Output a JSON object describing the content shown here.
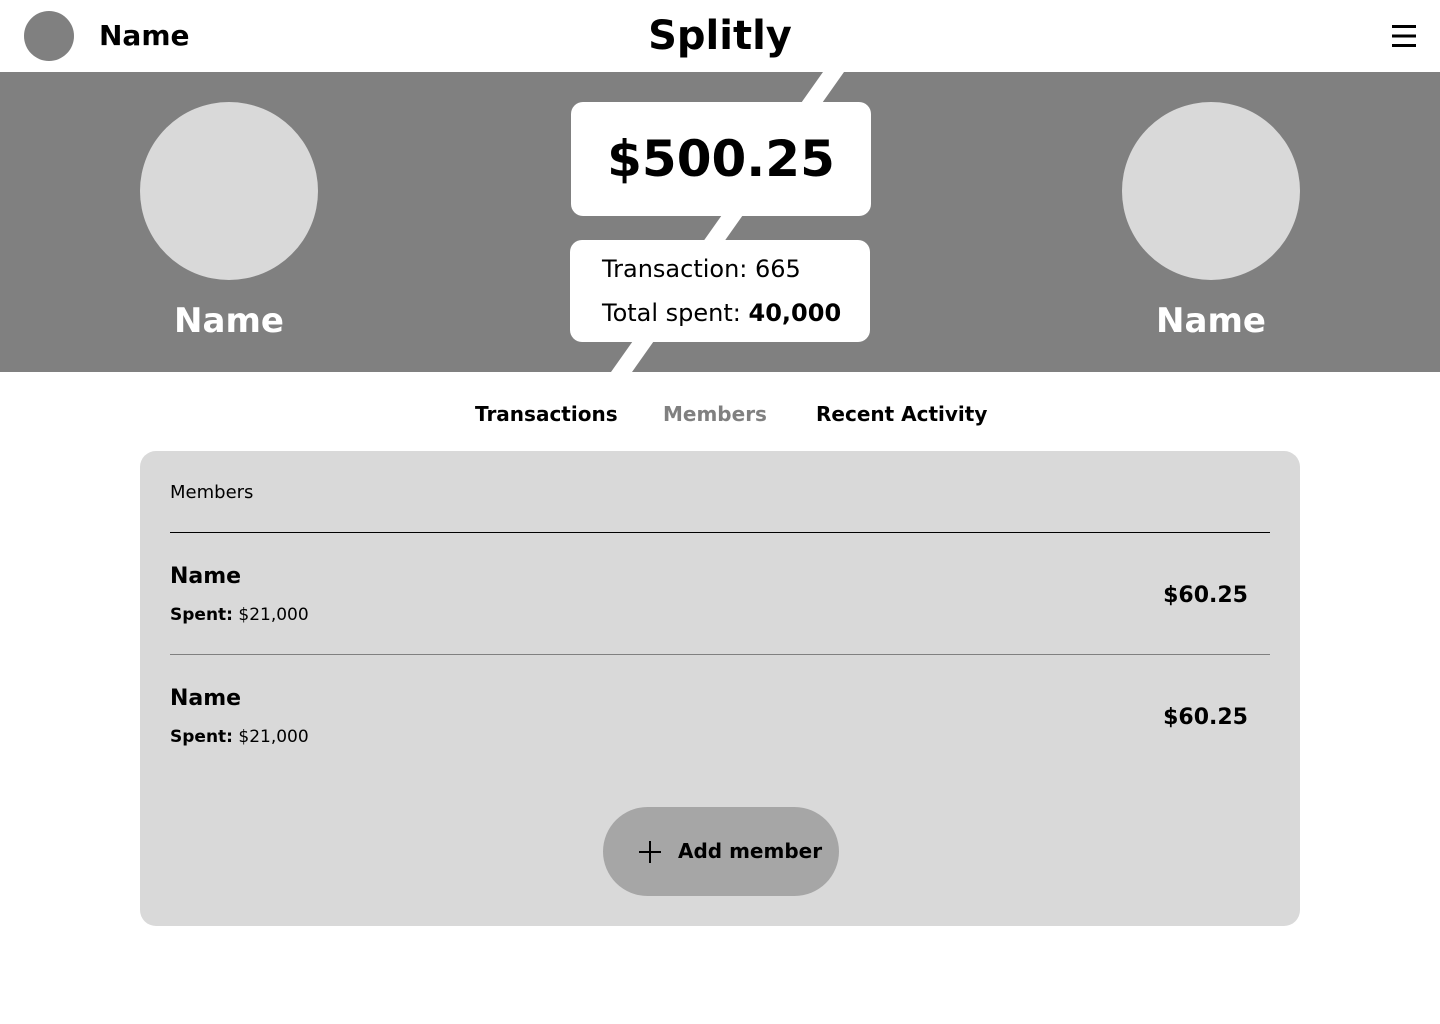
{
  "header": {
    "user_name": "Name",
    "app_title": "Splitly",
    "avatar_icon": "user-avatar",
    "menu_icon": "hamburger-menu-icon"
  },
  "hero": {
    "left_name": "Name",
    "right_name": "Name",
    "balance": "$500.25",
    "transaction_label": "Transaction: ",
    "transaction_count": "665",
    "total_spent_label": "Total spent: ",
    "total_spent_value": "40,000"
  },
  "tabs": [
    {
      "label": "Transactions"
    },
    {
      "label": "Members",
      "active": true
    },
    {
      "label": "Recent Activity"
    }
  ],
  "members_panel": {
    "title": "Members",
    "rows": [
      {
        "name": "Name",
        "spent_label": "Spent:",
        "spent_value": " $21,000",
        "balance": "$60.25"
      },
      {
        "name": "Name",
        "spent_label": "Spent:",
        "spent_value": " $21,000",
        "balance": "$60.25"
      }
    ],
    "add_button_label": "Add member",
    "add_icon": "plus-icon"
  },
  "colors": {
    "hero_bg": "#808080",
    "avatar_placeholder": "#d9d9d9",
    "panel_bg": "#d9d9d9",
    "button_bg": "#a6a6a6",
    "inactive_tab": "#808080"
  }
}
